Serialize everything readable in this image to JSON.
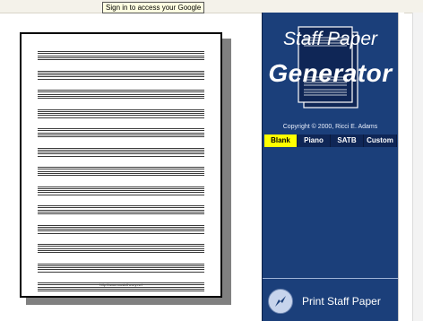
{
  "browser": {
    "tooltip": "Sign in to access your Google Bookmarks"
  },
  "preview": {
    "footer_url": "http://www.musictheory.net",
    "staff_count": 13
  },
  "panel": {
    "title_line1": "Staff Paper",
    "title_line2": "Generator",
    "copyright": "Copyright © 2000, Ricci E. Adams",
    "tabs": [
      {
        "label": "Blank",
        "active": true
      },
      {
        "label": "Piano",
        "active": false
      },
      {
        "label": "SATB",
        "active": false
      },
      {
        "label": "Custom",
        "active": false
      }
    ],
    "print_label": "Print Staff Paper",
    "colors": {
      "panel_bg": "#1b3f7a",
      "active_tab": "#ffff00"
    }
  }
}
